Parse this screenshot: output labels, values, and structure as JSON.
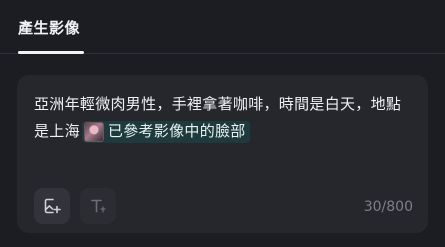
{
  "tabs": [
    {
      "label": "產生影像",
      "active": true
    }
  ],
  "prompt": {
    "text": "亞洲年輕微肉男性，手裡拿著咖啡，時間是白天，地點是上海",
    "reference_chip_label": "已參考影像中的臉部"
  },
  "toolbar": {
    "buttons": [
      {
        "icon": "add-image-icon"
      },
      {
        "icon": "text-format-icon",
        "disabled": true
      }
    ]
  },
  "counter": "30/800",
  "colors": {
    "background": "#1c1d22",
    "card": "#26272d",
    "chip": "#1f3a3c",
    "muted_text": "#7c7f88"
  }
}
